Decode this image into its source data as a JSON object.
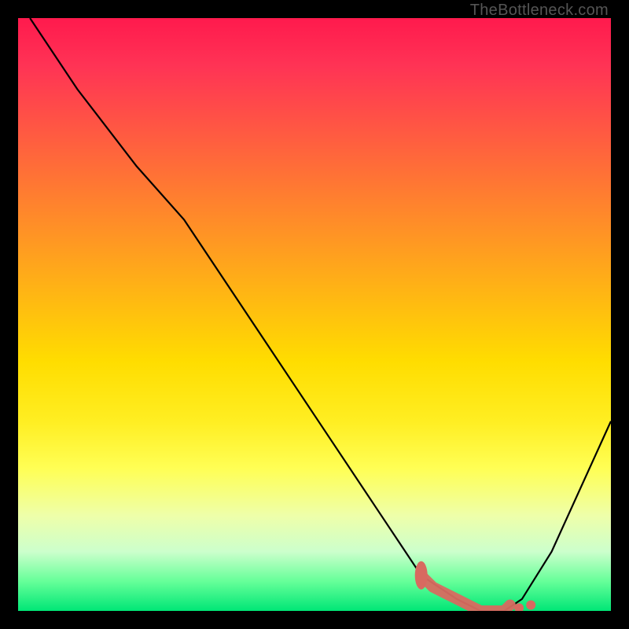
{
  "watermark": "TheBottleneck.com",
  "colors": {
    "gradient_top": "#ff1a4d",
    "gradient_bottom": "#00e676",
    "curve": "#000000",
    "marker": "#d86a60"
  },
  "chart_data": {
    "type": "line",
    "title": "",
    "xlabel": "",
    "ylabel": "",
    "xlim": [
      0,
      100
    ],
    "ylim": [
      0,
      100
    ],
    "series": [
      {
        "name": "bottleneck-curve",
        "x": [
          2,
          10,
          20,
          28,
          40,
          50,
          60,
          68,
          74,
          78,
          82,
          85,
          90,
          100
        ],
        "y": [
          100,
          88,
          75,
          66,
          48,
          33,
          18,
          6,
          2,
          0,
          0,
          2,
          10,
          32
        ]
      }
    ],
    "markers": {
      "name": "highlighted-range",
      "x": [
        68,
        70,
        72,
        74,
        76,
        78,
        80,
        82,
        83
      ],
      "y": [
        6,
        4,
        3,
        2,
        1,
        0,
        0,
        0,
        1
      ]
    }
  }
}
